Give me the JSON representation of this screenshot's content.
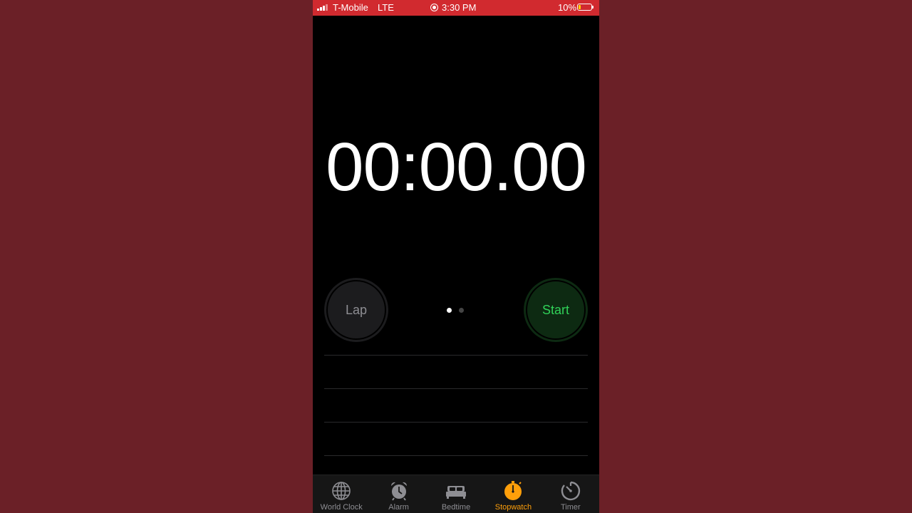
{
  "status_bar": {
    "carrier": "T-Mobile",
    "network": "LTE",
    "time": "3:30 PM",
    "battery": "10%",
    "colors": {
      "background": "#d12a2f",
      "battery_fill": "#ffd400"
    }
  },
  "stopwatch": {
    "display": "00:00.00"
  },
  "controls": {
    "lap_label": "Lap",
    "start_label": "Start",
    "page_indicator": {
      "pages": 2,
      "current": 1
    },
    "colors": {
      "lap_bg": "#1c1c1e",
      "lap_text": "#8e8e93",
      "start_bg": "#0d2a12",
      "start_text": "#30d158"
    }
  },
  "tab_bar": {
    "tabs": [
      {
        "label": "World Clock",
        "icon": "globe-icon",
        "active": false
      },
      {
        "label": "Alarm",
        "icon": "alarm-clock-icon",
        "active": false
      },
      {
        "label": "Bedtime",
        "icon": "bed-icon",
        "active": false
      },
      {
        "label": "Stopwatch",
        "icon": "stopwatch-icon",
        "active": true
      },
      {
        "label": "Timer",
        "icon": "timer-icon",
        "active": false
      }
    ],
    "colors": {
      "active": "#ff9f0a",
      "inactive": "#8e8e93"
    }
  }
}
